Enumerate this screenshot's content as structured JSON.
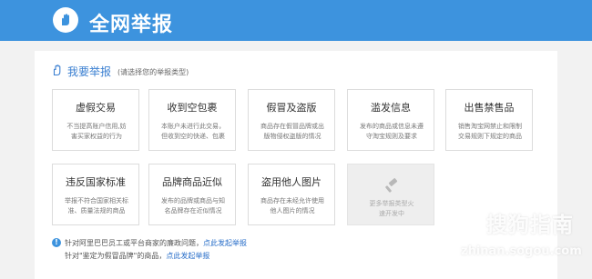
{
  "header": {
    "title": "全网举报",
    "logo_icon": "shield-hand-icon",
    "bg_color": "#3d93de"
  },
  "section": {
    "title": "我要举报",
    "hint": "(请选择您的举报类型)",
    "icon": "hand-icon"
  },
  "cards": [
    {
      "title": "虚假交易",
      "desc": "不当提高账户信用,妨\n害买家权益的行为"
    },
    {
      "title": "收到空包裹",
      "desc": "本账户未进行此交易，\n但收到空的快递、包裹"
    },
    {
      "title": "假冒及盗版",
      "desc": "商品存在假冒品牌或出\n版物侵权盗版的情况"
    },
    {
      "title": "滥发信息",
      "desc": "发布的商品或信息未遵\n守淘宝规则及要求"
    },
    {
      "title": "出售禁售品",
      "desc": "销售淘宝网禁止和限制\n交易规则下规定的商品"
    },
    {
      "title": "违反国家标准",
      "desc": "举报不符合国家相关标\n准、质量法规的商品"
    },
    {
      "title": "品牌商品近似",
      "desc": "发布的品牌或商品与知\n名品牌存在近似情况"
    },
    {
      "title": "盗用他人图片",
      "desc": "商品存在未经允许使用\n他人图片的情况"
    }
  ],
  "disabled_card": {
    "desc": "更多举报类型火\n速开发中",
    "icon": "gavel-icon"
  },
  "notes": [
    {
      "text": "针对阿里巴巴员工或平台商家的廉政问题，",
      "link": "点此发起举报"
    },
    {
      "text": "针对\"鉴定为假冒品牌\"的商品，",
      "link": "点此发起举报"
    }
  ],
  "watermark": {
    "text": "搜狗指南",
    "url": "zhinan.sogou.com"
  }
}
